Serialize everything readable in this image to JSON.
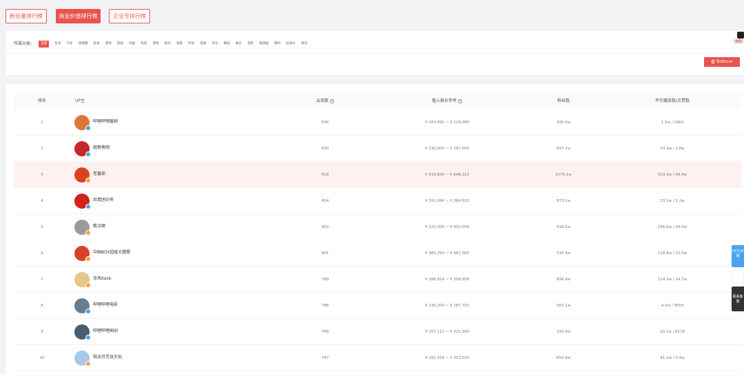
{
  "tabs": [
    {
      "label": "粉丝量排行榜",
      "active": false
    },
    {
      "label": "商业价值排行榜",
      "active": true
    },
    {
      "label": "企业号排行榜",
      "active": false
    }
  ],
  "filter": {
    "label": "所属分类：",
    "categories": [
      "全部",
      "生活",
      "汽车",
      "动物圈",
      "美食",
      "游戏",
      "影视",
      "动画",
      "科技",
      "游戏",
      "知识",
      "鬼畜",
      "时尚",
      "鬼畜",
      "音乐",
      "舞蹈",
      "娱乐",
      "电影",
      "电视剧",
      "数码",
      "纪录片",
      "资讯"
    ],
    "active_index": 0
  },
  "export_label": "导出Excel",
  "vip_label": "会员",
  "table": {
    "headers": {
      "rank": "排名",
      "up": "UP主",
      "cloud_index": "云指数",
      "price": "植入报价参考",
      "fans": "粉丝数",
      "avg": "平均播放数/点赞数"
    },
    "rows": [
      {
        "rank": "1",
        "name": "哔哩哔哩番剧",
        "cloud": "836",
        "price": "¥ 183,992 ~ ¥ 229,990",
        "fans": "395.6w",
        "avg": "1.5w / 1964",
        "avatar_color": "#e0743a",
        "badge_color": "#4aa3f0",
        "highlight": false
      },
      {
        "rank": "2",
        "name": "观察者网",
        "cloud": "830",
        "price": "¥ 230,000 ~ ¥ 287,500",
        "fans": "697.2w",
        "avg": "33.3w / 2.8w",
        "avatar_color": "#c8262b",
        "badge_color": "#4aa3f0",
        "highlight": false
      },
      {
        "rank": "3",
        "name": "老番茄",
        "cloud": "818",
        "price": "¥ 518,650 ~ ¥ 648,313",
        "fans": "1574.1w",
        "avg": "503.4w / 48.4w",
        "avatar_color": "#d8431f",
        "badge_color": "#f1a33c",
        "highlight": true
      },
      {
        "rank": "4",
        "name": "共青团中央",
        "cloud": "804",
        "price": "¥ 291,696 ~ ¥ 364,620",
        "fans": "873.1w",
        "avg": "33.1w / 5.2w",
        "avatar_color": "#d3241c",
        "badge_color": "#4aa3f0",
        "highlight": false
      },
      {
        "rank": "5",
        "name": "敬汉卿",
        "cloud": "803",
        "price": "¥ 322,000 ~ ¥ 402,500",
        "fans": "918.2w",
        "avg": "166.6w / 16.0w",
        "avatar_color": "#9a9a9a",
        "badge_color": "#f1a33c",
        "highlight": false
      },
      {
        "rank": "6",
        "name": "中国BOY超级大猩猩",
        "cloud": "801",
        "price": "¥ 385,250 ~ ¥ 481,563",
        "fans": "735.4w",
        "avg": "128.8w / 13.0w",
        "avatar_color": "#d9412b",
        "badge_color": "#f1a33c",
        "highlight": false
      },
      {
        "rank": "7",
        "name": "凉风Kaze",
        "cloud": "789",
        "price": "¥ 286,924 ~ ¥ 358,656",
        "fans": "806.4w",
        "avg": "214.2w / 24.2w",
        "avatar_color": "#e7c68a",
        "badge_color": "#f1a33c",
        "highlight": false
      },
      {
        "rank": "8",
        "name": "哔哩哔哩电影",
        "cloud": "788",
        "price": "¥ 230,200 ~ ¥ 287,750",
        "fans": "567.1w",
        "avg": "4.3w / 3659",
        "avatar_color": "#6b7d8c",
        "badge_color": "#4aa3f0",
        "highlight": false
      },
      {
        "rank": "9",
        "name": "哔哩哔哩国创",
        "cloud": "788",
        "price": "¥ 257,112 ~ ¥ 321,390",
        "fans": "330.9w",
        "avg": "20.1w / 8178",
        "avatar_color": "#4a5d6e",
        "badge_color": "#4aa3f0",
        "highlight": false
      },
      {
        "rank": "10",
        "name": "指法芬芳张大仙",
        "cloud": "787",
        "price": "¥ 282,416 ~ ¥ 353,020",
        "fans": "650.6w",
        "avg": "41.2w / 3.4w",
        "avatar_color": "#a8c8e8",
        "badge_color": "#f1a33c",
        "highlight": false
      }
    ]
  },
  "side": {
    "blue_label": "UP主对接",
    "dark_label": "联系客服"
  }
}
